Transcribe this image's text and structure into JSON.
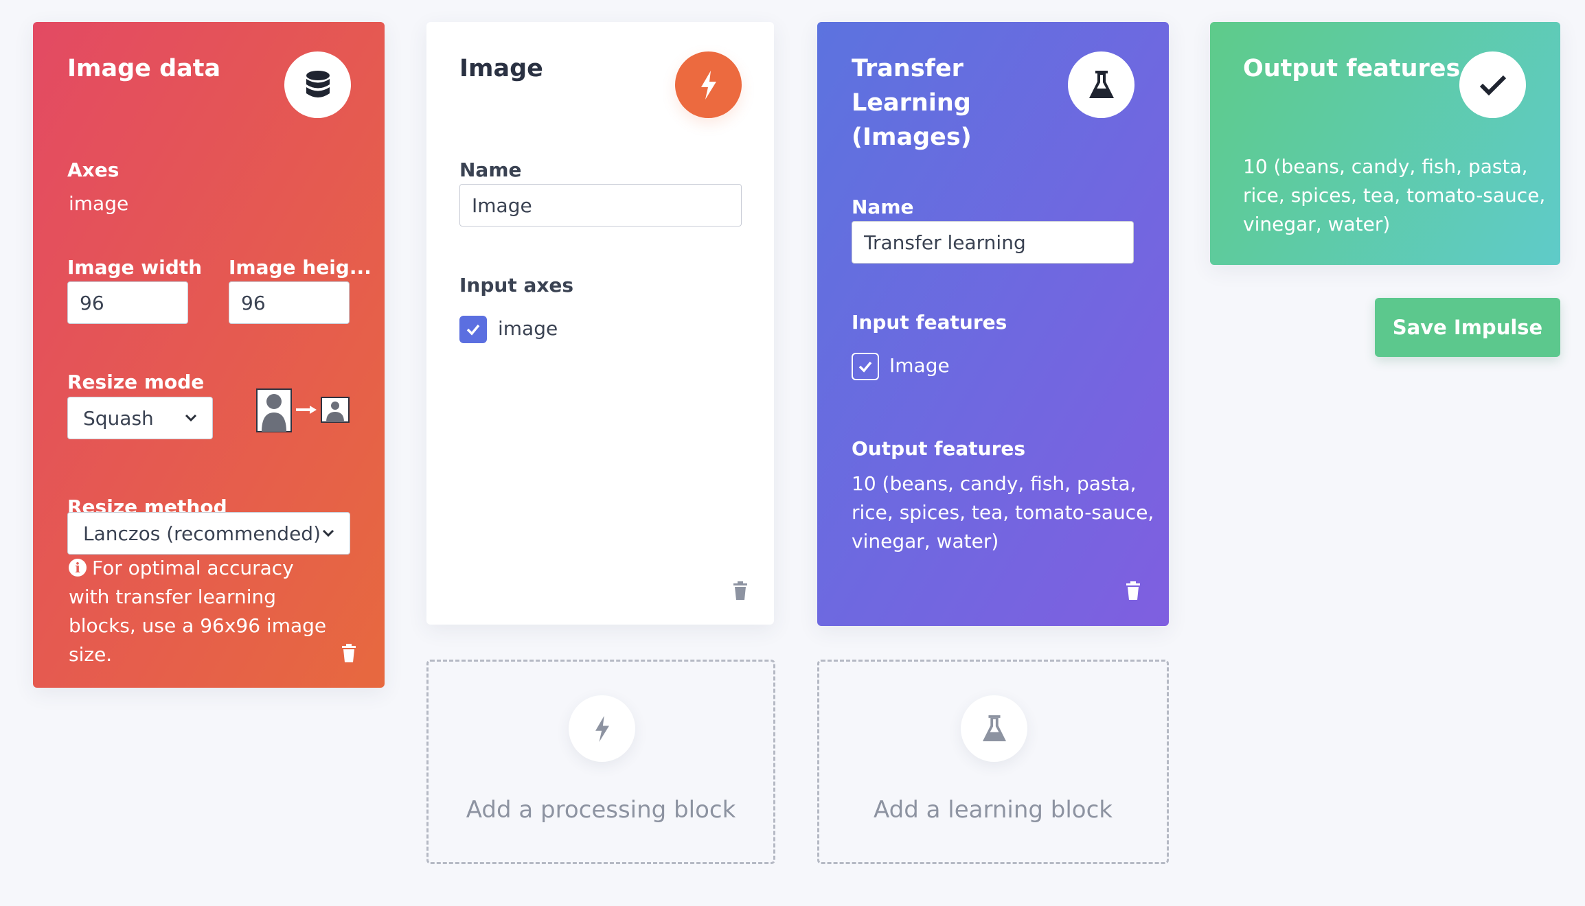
{
  "image_data_block": {
    "title": "Image data",
    "icon": "database-icon",
    "axes_label": "Axes",
    "axes_value": "image",
    "width_label": "Image width",
    "height_label": "Image heig...",
    "width_value": "96",
    "height_value": "96",
    "resize_mode_label": "Resize mode",
    "resize_mode_value": "Squash",
    "resize_method_label": "Resize method",
    "resize_method_value": "Lanczos (recommended)",
    "hint_line1": "For optimal accuracy",
    "hint_line2": "with transfer learning",
    "hint_line3": "blocks, use a 96x96 image",
    "hint_line4": "size.",
    "colors": {
      "from": "#e34a63",
      "to": "#e7693f"
    }
  },
  "processing_block": {
    "title": "Image",
    "icon": "lightning-icon",
    "name_label": "Name",
    "name_value": "Image",
    "input_axes_label": "Input axes",
    "axis_item": "image",
    "accent": "#ec6a3f"
  },
  "learning_block": {
    "title_line1": "Transfer",
    "title_line2": "Learning",
    "title_line3": "(Images)",
    "icon": "flask-icon",
    "name_label": "Name",
    "name_value": "Transfer learning",
    "input_features_label": "Input features",
    "input_feature_item": "Image",
    "output_features_label": "Output features",
    "output_line1": "10 (beans, candy, fish, pasta,",
    "output_line2": "rice, spices, tea, tomato-sauce,",
    "output_line3": "vinegar, water)",
    "colors": {
      "from": "#5c73df",
      "to": "#7f5fe0"
    }
  },
  "output_block": {
    "title": "Output features",
    "icon": "checkmark-icon",
    "line1": "10 (beans, candy, fish, pasta,",
    "line2": "rice, spices, tea, tomato-sauce,",
    "line3": "vinegar, water)",
    "colors": {
      "from": "#5ecb8a",
      "to": "#5fcbc9"
    }
  },
  "add_processing": {
    "label": "Add a processing block",
    "icon": "lightning-icon"
  },
  "add_learning": {
    "label": "Add a learning block",
    "icon": "flask-icon"
  },
  "save_button": {
    "label": "Save Impulse",
    "color": "#5cc88d"
  }
}
